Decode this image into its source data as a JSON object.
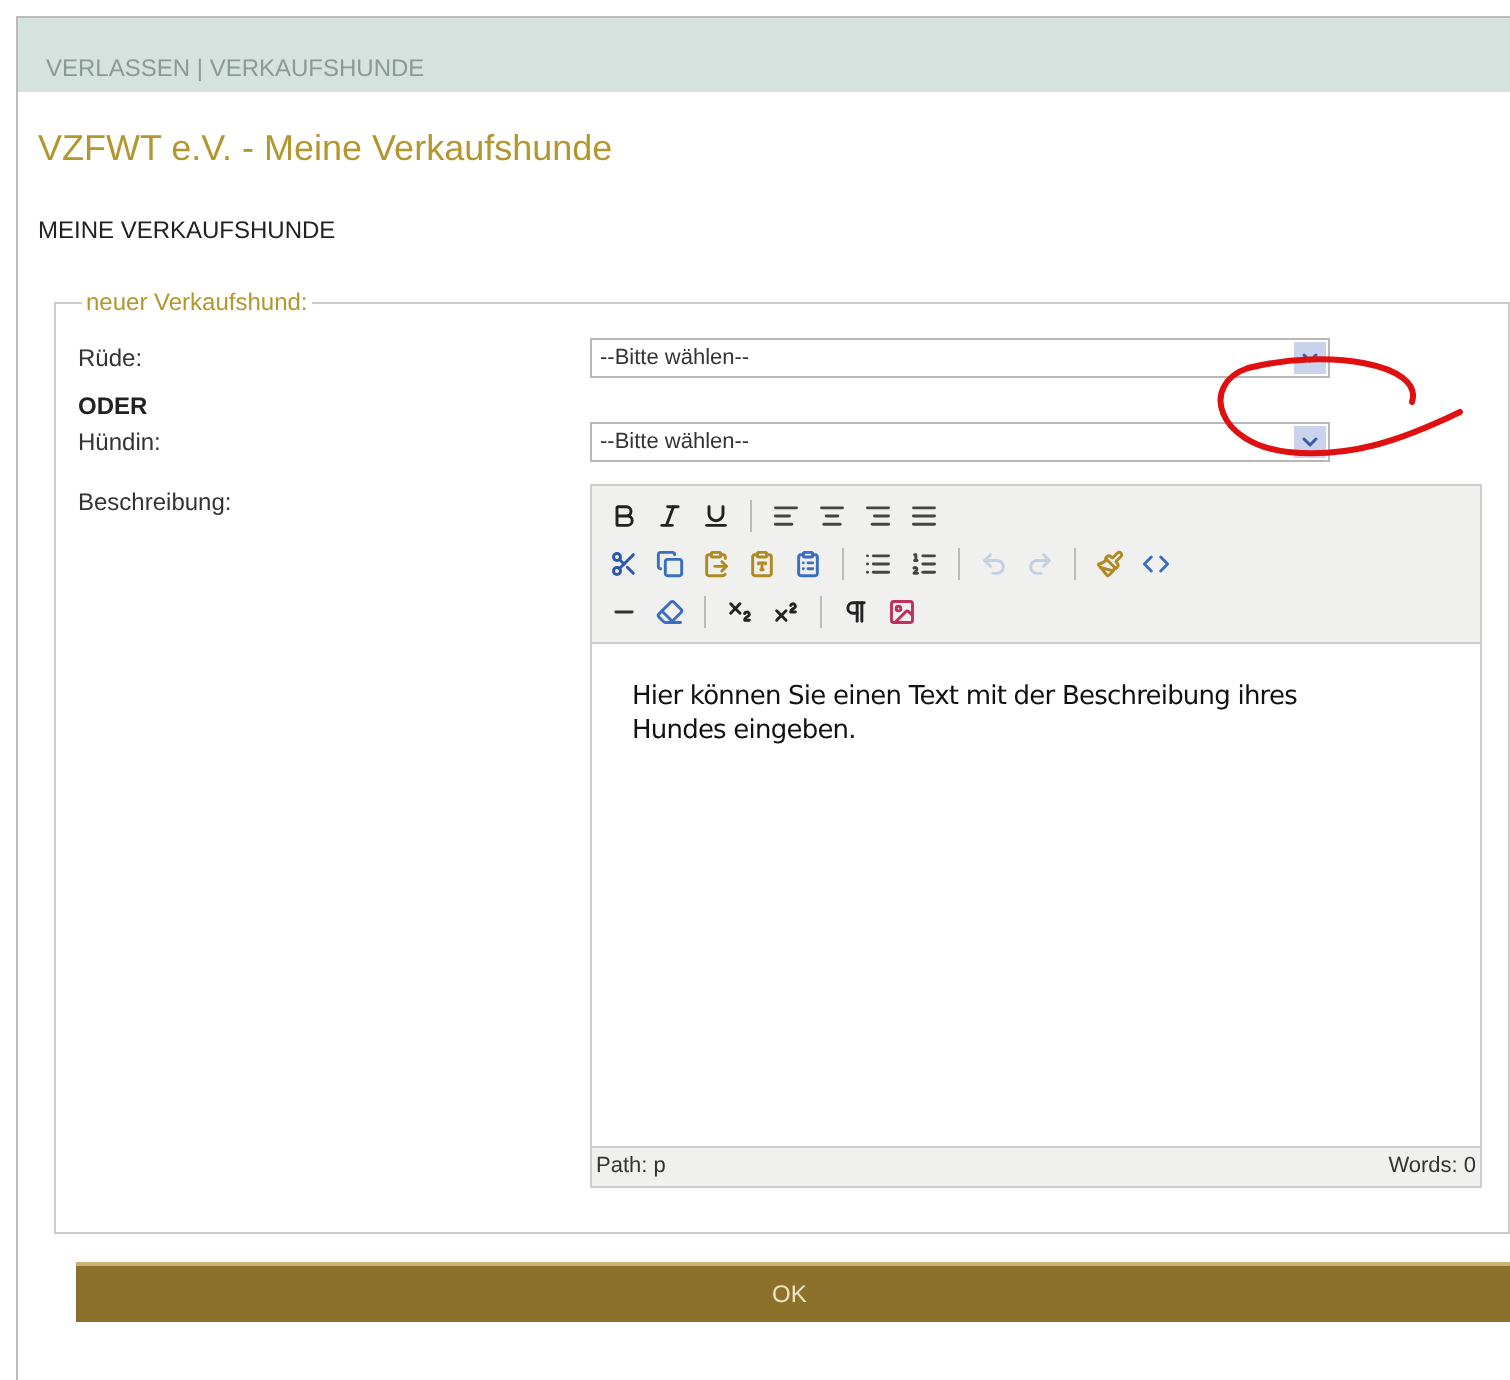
{
  "breadcrumb": "VERLASSEN | VERKAUFSHUNDE",
  "title": "VZFWT e.V. - Meine Verkaufshunde",
  "subtitle": "MEINE VERKAUFSHUNDE",
  "fieldset": {
    "legend": "neuer Verkaufshund:",
    "fields": [
      {
        "kind": "select",
        "label": "Rüde:",
        "value": "--Bitte wählen--"
      },
      {
        "kind": "note",
        "label": "ODER"
      },
      {
        "kind": "select",
        "label": "Hündin:",
        "value": "--Bitte wählen--"
      },
      {
        "kind": "editor",
        "label": "Beschreibung:"
      }
    ]
  },
  "editor": {
    "toolbar": [
      [
        {
          "disabled": false
        },
        {
          "disabled": false
        },
        {
          "disabled": false
        },
        {
          "disabled": false
        },
        {
          "disabled": false
        },
        {
          "disabled": false
        },
        {
          "disabled": false
        }
      ],
      [
        {
          "disabled": false
        },
        {
          "disabled": false
        },
        {
          "disabled": false
        },
        {
          "disabled": false
        },
        {
          "disabled": false
        },
        {
          "disabled": false
        },
        {
          "disabled": false
        },
        {
          "disabled": true
        },
        {
          "disabled": true
        },
        {
          "disabled": false
        },
        {
          "disabled": false
        }
      ],
      [
        {
          "disabled": false
        },
        {
          "disabled": false
        },
        {
          "disabled": false
        },
        {
          "disabled": false
        },
        {
          "disabled": false
        },
        {
          "disabled": false
        }
      ]
    ],
    "content": "Hier können Sie einen Text mit der Beschreibung ihres Hundes eingeben.",
    "path": "Path: p",
    "words": "Words: 0"
  },
  "ok_button": "OK"
}
